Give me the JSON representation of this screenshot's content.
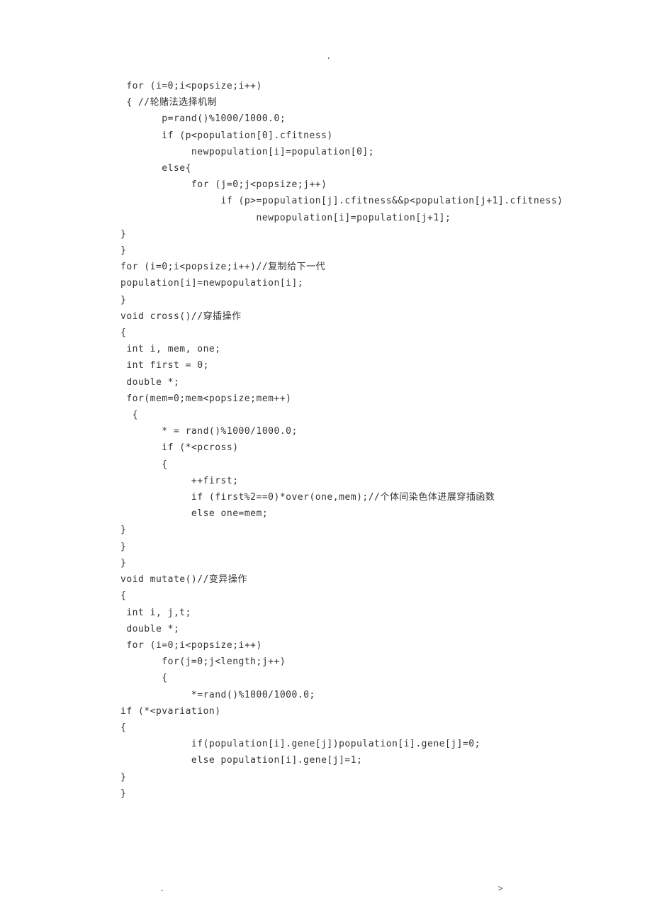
{
  "header_dot": ".",
  "code_lines": [
    " for (i=0;i<popsize;i++)",
    " { //轮赌法选择机制",
    "       p=rand()%1000/1000.0;",
    "       if (p<population[0].cfitness)",
    "            newpopulation[i]=population[0];",
    "       else{",
    "            for (j=0;j<popsize;j++)",
    "                 if (p>=population[j].cfitness&&p<population[j+1].cfitness)",
    "                       newpopulation[i]=population[j+1];",
    "}",
    "}",
    "for (i=0;i<popsize;i++)//复制给下一代",
    "population[i]=newpopulation[i];",
    "}",
    "void cross()//穿插操作",
    "{",
    " int i, mem, one;",
    " int first = 0;",
    " double *;",
    " for(mem=0;mem<popsize;mem++)",
    "  {",
    "       * = rand()%1000/1000.0;",
    "       if (*<pcross)",
    "       {",
    "            ++first;",
    "            if (first%2==0)*over(one,mem);//个体间染色体进展穿插函数",
    "            else one=mem;",
    "}",
    "}",
    "}",
    "void mutate()//变异操作",
    "{",
    " int i, j,t;",
    " double *;",
    " for (i=0;i<popsize;i++)",
    "       for(j=0;j<length;j++)",
    "       {",
    "            *=rand()%1000/1000.0;",
    "if (*<pvariation)",
    "{",
    "            if(population[i].gene[j])population[i].gene[j]=0;",
    "            else population[i].gene[j]=1;",
    "}",
    "}"
  ],
  "footer_dot": ".",
  "footer_gt": ">"
}
